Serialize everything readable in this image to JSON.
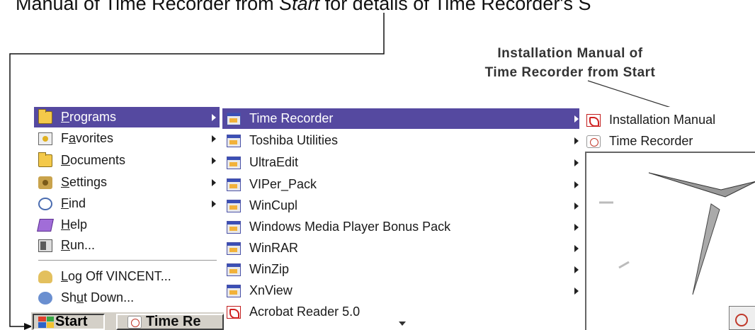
{
  "caption": {
    "before": "Manual of Time Recorder from ",
    "italic": "Start",
    "after": " for details of Time Recorder's S"
  },
  "callout": {
    "line1": "Installation Manual of",
    "line2": "Time Recorder from Start"
  },
  "start_menu": {
    "items": [
      {
        "pre": "",
        "key": "P",
        "post": "rograms",
        "icon": "folder-icon",
        "submenu": true,
        "highlighted": true
      },
      {
        "pre": "F",
        "key": "a",
        "post": "vorites",
        "icon": "favorites-icon",
        "submenu": true
      },
      {
        "pre": "",
        "key": "D",
        "post": "ocuments",
        "icon": "documents-icon",
        "submenu": true
      },
      {
        "pre": "",
        "key": "S",
        "post": "ettings",
        "icon": "settings-icon",
        "submenu": true
      },
      {
        "pre": "",
        "key": "F",
        "post": "ind",
        "icon": "find-icon",
        "submenu": true
      },
      {
        "pre": "",
        "key": "H",
        "post": "elp",
        "icon": "help-icon",
        "submenu": false
      },
      {
        "pre": "",
        "key": "R",
        "post": "un...",
        "icon": "run-icon",
        "submenu": false
      },
      {
        "pre": "",
        "key": "L",
        "post": "og Off VINCENT...",
        "icon": "log-off-icon",
        "submenu": false
      },
      {
        "pre": "Sh",
        "key": "u",
        "post": "t Down...",
        "icon": "shut-down-icon",
        "submenu": false
      }
    ]
  },
  "programs_menu": {
    "items": [
      {
        "label": "Time Recorder",
        "submenu": true,
        "highlighted": true
      },
      {
        "label": "Toshiba Utilities",
        "submenu": true
      },
      {
        "label": "UltraEdit",
        "submenu": true
      },
      {
        "label": "VIPer_Pack",
        "submenu": true
      },
      {
        "label": "WinCupl",
        "submenu": true
      },
      {
        "label": "Windows Media Player Bonus Pack",
        "submenu": true
      },
      {
        "label": "WinRAR",
        "submenu": true
      },
      {
        "label": "WinZip",
        "submenu": true
      },
      {
        "label": "XnView",
        "submenu": true
      },
      {
        "label": "Acrobat Reader 5.0",
        "submenu": false
      }
    ]
  },
  "time_recorder_menu": {
    "items": [
      {
        "label": "Installation Manual",
        "icon": "pdf-icon"
      },
      {
        "label": "Time Recorder",
        "icon": "time-recorder-icon"
      }
    ]
  },
  "taskbar": {
    "start_label": "Start",
    "task_label": "Time Re"
  },
  "colors": {
    "highlight": "#5549a0",
    "menu_background": "#ffffff",
    "taskbar": "#d4d0c8"
  }
}
